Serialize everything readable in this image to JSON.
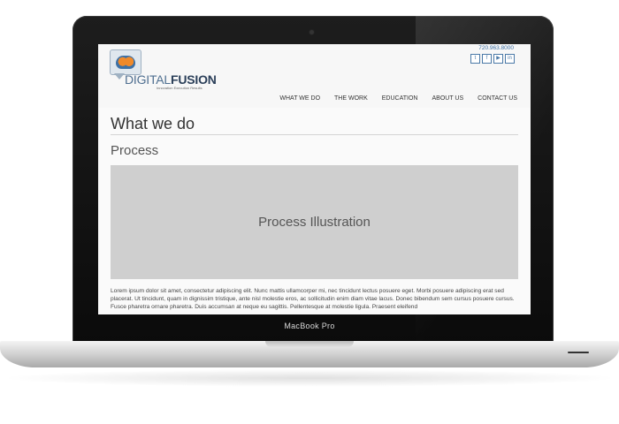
{
  "device": {
    "label": "MacBook Pro"
  },
  "site": {
    "logo": {
      "word1": "DIGITAL",
      "word2": "FUSION",
      "tagline": "Innovation Execution Results"
    },
    "phone": "720.963.8000",
    "social": [
      {
        "name": "twitter-icon",
        "glyph": "t"
      },
      {
        "name": "facebook-icon",
        "glyph": "f"
      },
      {
        "name": "youtube-icon",
        "glyph": "▶"
      },
      {
        "name": "linkedin-icon",
        "glyph": "in"
      }
    ],
    "nav": [
      "WHAT WE DO",
      "THE WORK",
      "EDUCATION",
      "ABOUT US",
      "CONTACT US"
    ]
  },
  "page": {
    "title": "What we do",
    "section": "Process",
    "illustration_label": "Process Illustration",
    "body": "Lorem ipsum dolor sit amet, consectetur adipiscing elit. Nunc mattis ullamcorper mi, nec tincidunt lectus posuere eget. Morbi posuere adipiscing erat sed placerat. Ut tincidunt, quam in dignissim tristique, ante nisl molestie eros, ac sollicitudin enim diam vitae lacus. Donec bibendum sem cursus posuere cursus. Fusce pharetra ornare pharetra. Duis accumsan at neque eu sagittis. Pellentesque at molestie ligula. Praesent eleifend"
  }
}
